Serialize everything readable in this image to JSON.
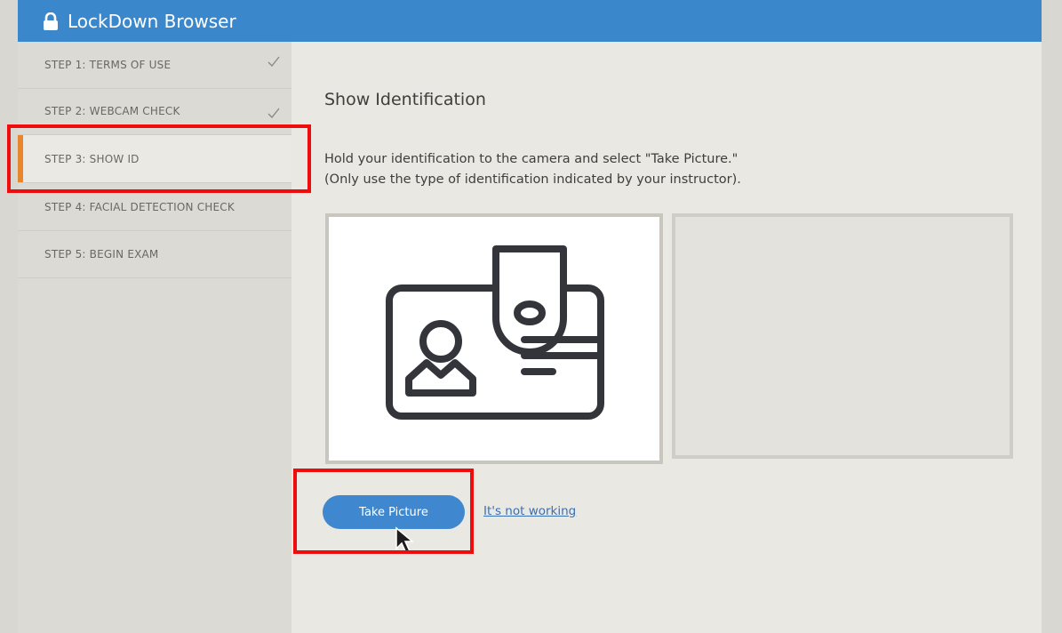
{
  "app": {
    "title": "LockDown Browser",
    "icon": "lock-icon"
  },
  "sidebar": {
    "steps": [
      {
        "label": "STEP 1: TERMS OF USE",
        "completed": true
      },
      {
        "label": "STEP 2: WEBCAM CHECK",
        "completed": true
      },
      {
        "label": "STEP 3: SHOW ID",
        "active": true
      },
      {
        "label": "STEP 4: FACIAL DETECTION CHECK"
      },
      {
        "label": "STEP 5: BEGIN EXAM"
      }
    ]
  },
  "main": {
    "heading": "Show Identification",
    "instruction_line1": "Hold your identification to the camera and select \"Take Picture.\"",
    "instruction_line2": "(Only use the type of identification indicated by your instructor).",
    "preview_icon": "id-badge-icon",
    "take_picture_label": "Take Picture",
    "not_working_label": "It's not working"
  },
  "colors": {
    "titlebar": "#3a87cc",
    "active_step_accent": "#e8862d",
    "primary_button": "#3f87cf",
    "highlight": "#ee0c0c"
  }
}
